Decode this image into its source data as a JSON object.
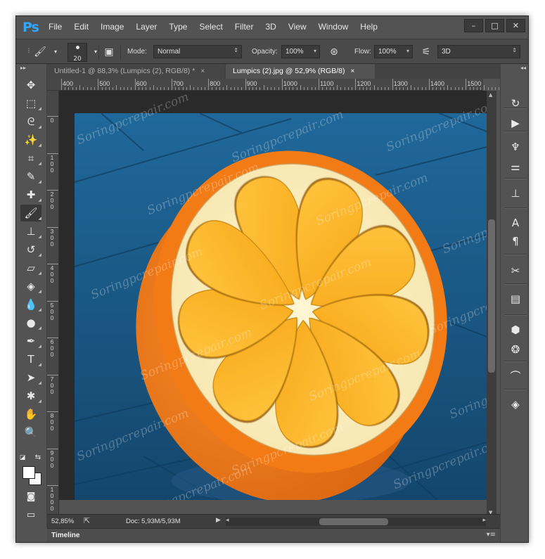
{
  "app": {
    "logo": "Ps"
  },
  "menu": [
    "File",
    "Edit",
    "Image",
    "Layer",
    "Type",
    "Select",
    "Filter",
    "3D",
    "View",
    "Window",
    "Help"
  ],
  "window_controls": {
    "minimize": "–",
    "maximize": "□",
    "close": "✕"
  },
  "options_bar": {
    "brush_size": "20",
    "mode_label": "Mode:",
    "mode_value": "Normal",
    "opacity_label": "Opacity:",
    "opacity_value": "100%",
    "flow_label": "Flow:",
    "flow_value": "100%",
    "threed_value": "3D"
  },
  "tabs": [
    {
      "label": "Untitled-1 @ 88,3% (Lumpics (2), RGB/8) *",
      "close": "×",
      "active": false
    },
    {
      "label": "Lumpics (2).jpg @ 52,9% (RGB/8)",
      "close": "×",
      "active": true
    }
  ],
  "ruler_h": [
    "400",
    "500",
    "600",
    "700",
    "800",
    "900",
    "1000",
    "1100",
    "1200",
    "1300",
    "1400",
    "1500"
  ],
  "ruler_v": [
    "0",
    "1\n0\n0",
    "2\n0\n0",
    "3\n0\n0",
    "4\n0\n0",
    "5\n0\n0",
    "6\n0\n0",
    "7\n0\n0",
    "8\n0\n0",
    "9\n0\n0",
    "1\n0\n0\n0"
  ],
  "watermark": "Soringpcrepair.com",
  "status": {
    "zoom": "52,85%",
    "doc": "Doc: 5,93M/5,93M"
  },
  "timeline": {
    "label": "Timeline"
  },
  "tools": [
    {
      "name": "move-tool-icon",
      "glyph": "✥"
    },
    {
      "name": "marquee-tool-icon",
      "glyph": "⬚"
    },
    {
      "name": "lasso-tool-icon",
      "glyph": "ᘓ"
    },
    {
      "name": "magic-wand-tool-icon",
      "glyph": "✨"
    },
    {
      "name": "crop-tool-icon",
      "glyph": "⌗"
    },
    {
      "name": "eyedropper-tool-icon",
      "glyph": "✎"
    },
    {
      "name": "healing-brush-tool-icon",
      "glyph": "✚"
    },
    {
      "name": "brush-tool-icon",
      "glyph": "🖌"
    },
    {
      "name": "clone-stamp-tool-icon",
      "glyph": "⊥"
    },
    {
      "name": "history-brush-tool-icon",
      "glyph": "↺"
    },
    {
      "name": "eraser-tool-icon",
      "glyph": "▱"
    },
    {
      "name": "paint-bucket-tool-icon",
      "glyph": "◈"
    },
    {
      "name": "blur-tool-icon",
      "glyph": "💧"
    },
    {
      "name": "dodge-tool-icon",
      "glyph": "●"
    },
    {
      "name": "pen-tool-icon",
      "glyph": "✒"
    },
    {
      "name": "type-tool-icon",
      "glyph": "T"
    },
    {
      "name": "path-selection-tool-icon",
      "glyph": "➤"
    },
    {
      "name": "custom-shape-tool-icon",
      "glyph": "✱"
    },
    {
      "name": "hand-tool-icon",
      "glyph": "✋"
    },
    {
      "name": "zoom-tool-icon",
      "glyph": "🔍"
    }
  ],
  "right_panel": [
    {
      "name": "history-panel-icon",
      "glyph": "↻"
    },
    {
      "name": "actions-panel-icon",
      "glyph": "▶"
    },
    {
      "name": "brush-presets-panel-icon",
      "glyph": "♆"
    },
    {
      "name": "adjustments-panel-icon",
      "glyph": "⚌"
    },
    {
      "name": "clone-source-panel-icon",
      "glyph": "⊥"
    },
    {
      "name": "character-panel-icon",
      "glyph": "A"
    },
    {
      "name": "paragraph-panel-icon",
      "glyph": "¶"
    },
    {
      "name": "tools-presets-panel-icon",
      "glyph": "✂"
    },
    {
      "name": "properties-panel-icon",
      "glyph": "▤"
    },
    {
      "name": "3d-panel-icon",
      "glyph": "⬢"
    },
    {
      "name": "channels-panel-icon",
      "glyph": "❂"
    },
    {
      "name": "paths-panel-icon",
      "glyph": "⌒"
    },
    {
      "name": "layers-panel-icon",
      "glyph": "◈"
    }
  ],
  "colors": {
    "ui_background": "#535353",
    "ps_blue": "#31a8ff",
    "orange_peel": "#f37b15",
    "segment": "#ffb627",
    "pith": "#fbeebd",
    "table_blue": "#1f5e8c"
  }
}
